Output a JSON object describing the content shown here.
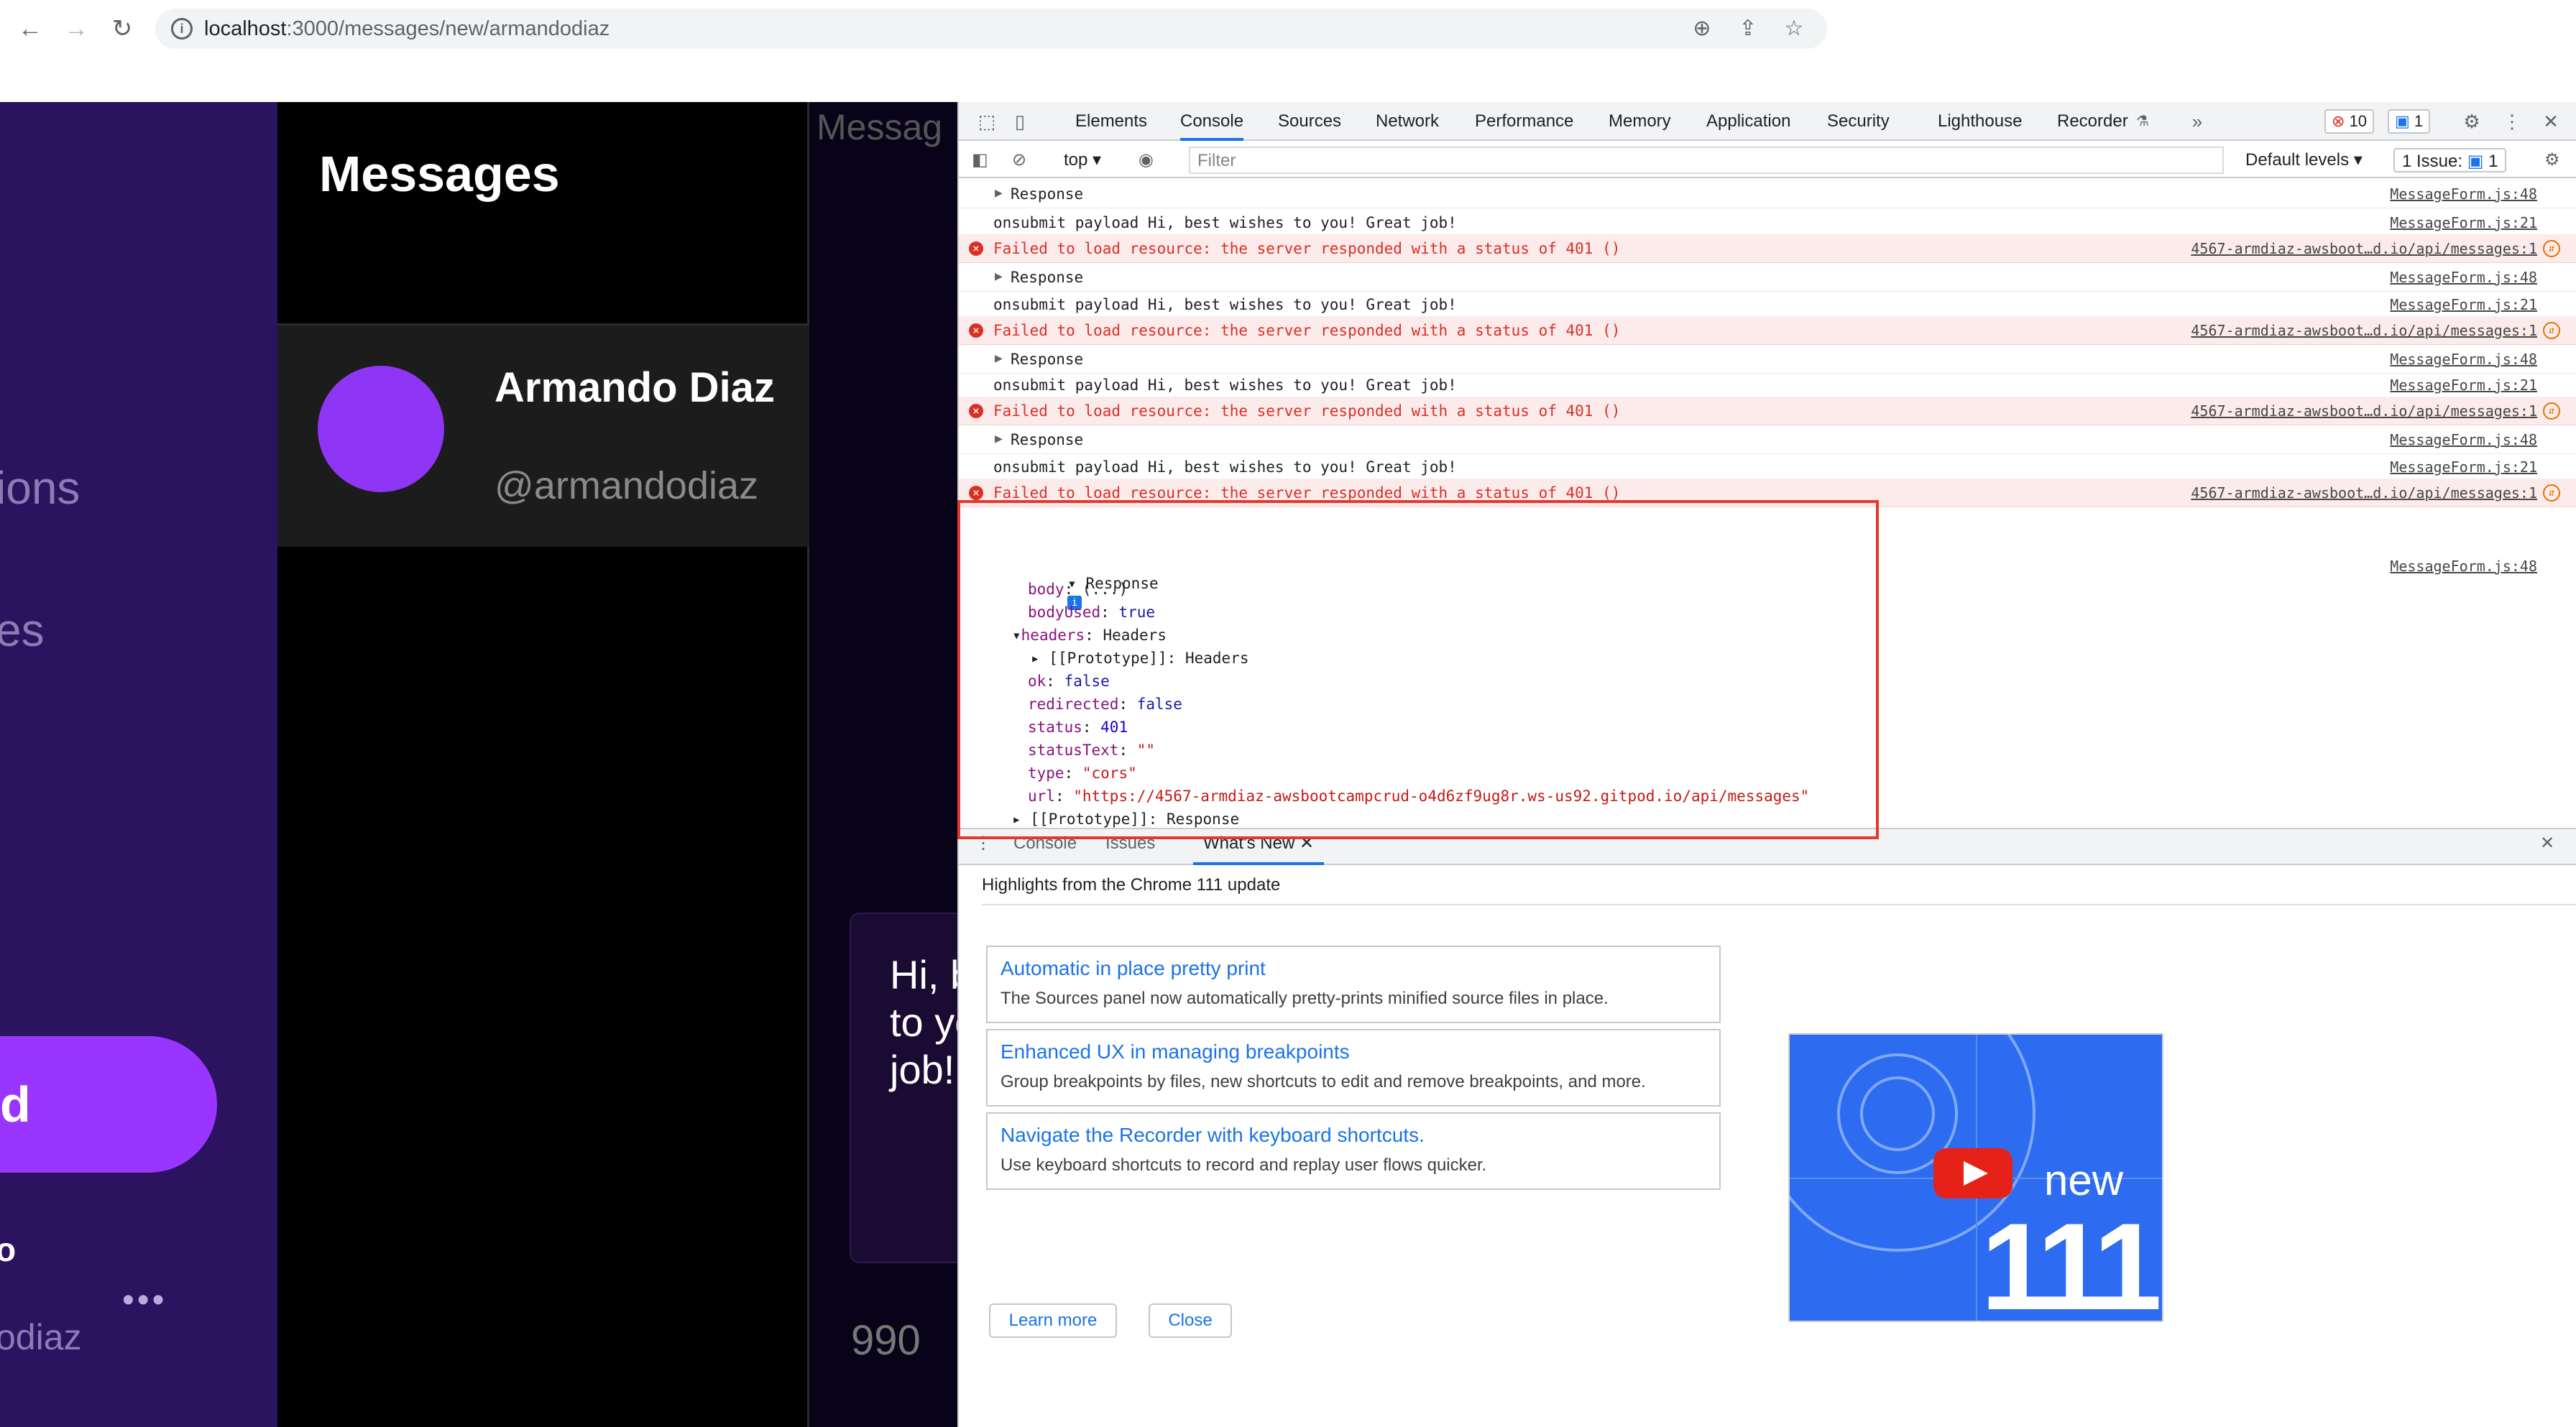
{
  "browser": {
    "url_host": "localhost",
    "url_path": ":3000/messages/new/armandodiaz"
  },
  "app": {
    "sidebar": {
      "nav_fragments": [
        "ions",
        "es"
      ],
      "crud_label": "d",
      "user_name_fragment": "o",
      "more_label": "•••",
      "user_handle_fragment": "odiaz"
    },
    "messages_title": "Messages",
    "group": {
      "name": "Armando Diaz",
      "handle": "@armandodiaz"
    },
    "thread": {
      "header_fragment": "Messag",
      "bubble_text": "Hi, b\nto yo\njob!",
      "count": "990"
    }
  },
  "devtools": {
    "tabs": [
      "Elements",
      "Console",
      "Sources",
      "Network",
      "Performance",
      "Memory",
      "Application",
      "Security",
      "Lighthouse",
      "Recorder"
    ],
    "active_tab": "Console",
    "error_count": "10",
    "message_count": "1",
    "toolbar": {
      "context": "top",
      "filter_placeholder": "Filter",
      "levels": "Default levels",
      "issues_label": "1 Issue:",
      "issues_count": "1"
    },
    "console_rows": [
      {
        "type": "log",
        "expandable": true,
        "text": "Response",
        "src": "MessageForm.js:48"
      },
      {
        "type": "log",
        "expandable": false,
        "text": "onsubmit payload Hi, best wishes to you! Great job!",
        "src": "MessageForm.js:21"
      },
      {
        "type": "error",
        "text": "Failed to load resource: the server responded with a status of 401 ()",
        "src": "4567-armdiaz-awsboot…d.io/api/messages:1"
      },
      {
        "type": "log",
        "expandable": true,
        "text": "Response",
        "src": "MessageForm.js:48"
      },
      {
        "type": "log",
        "expandable": false,
        "text": "onsubmit payload Hi, best wishes to you! Great job!",
        "src": "MessageForm.js:21"
      },
      {
        "type": "error",
        "text": "Failed to load resource: the server responded with a status of 401 ()",
        "src": "4567-armdiaz-awsboot…d.io/api/messages:1"
      },
      {
        "type": "log",
        "expandable": true,
        "text": "Response",
        "src": "MessageForm.js:48"
      },
      {
        "type": "log",
        "expandable": false,
        "text": "onsubmit payload Hi, best wishes to you! Great job!",
        "src": "MessageForm.js:21"
      },
      {
        "type": "error",
        "text": "Failed to load resource: the server responded with a status of 401 ()",
        "src": "4567-armdiaz-awsboot…d.io/api/messages:1"
      },
      {
        "type": "log",
        "expandable": true,
        "text": "Response",
        "src": "MessageForm.js:48"
      },
      {
        "type": "log",
        "expandable": false,
        "text": "onsubmit payload Hi, best wishes to you! Great job!",
        "src": "MessageForm.js:21"
      },
      {
        "type": "error",
        "text": "Failed to load resource: the server responded with a status of 401 ()",
        "src": "4567-armdiaz-awsboot…d.io/api/messages:1"
      }
    ],
    "response_tree": {
      "label": "Response",
      "src": "MessageForm.js:48",
      "body": "(...)",
      "bodyUsed": "true",
      "headers": "Headers",
      "headers_proto": "Headers",
      "ok": "false",
      "redirected": "false",
      "status": "401",
      "statusText": "\"\"",
      "type": "\"cors\"",
      "url": "\"https://4567-armdiaz-awsbootcampcrud-o4d6zf9ug8r.ws-us92.gitpod.io/api/messages\"",
      "proto": "Response"
    },
    "drawer": {
      "tabs": [
        "Console",
        "Issues",
        "What's New"
      ],
      "active": "What's New",
      "subtitle": "Highlights from the Chrome 111 update",
      "cards": [
        {
          "title": "Automatic in place pretty print",
          "desc": "The Sources panel now automatically pretty-prints minified source files in place."
        },
        {
          "title": "Enhanced UX in managing breakpoints",
          "desc": "Group breakpoints by files, new shortcuts to edit and remove breakpoints, and more."
        },
        {
          "title": "Navigate the Recorder with keyboard shortcuts.",
          "desc": "Use keyboard shortcuts to record and replay user flows quicker."
        }
      ],
      "learn_more": "Learn more",
      "close": "Close",
      "thumb_new": "new",
      "thumb_version": "111"
    }
  }
}
